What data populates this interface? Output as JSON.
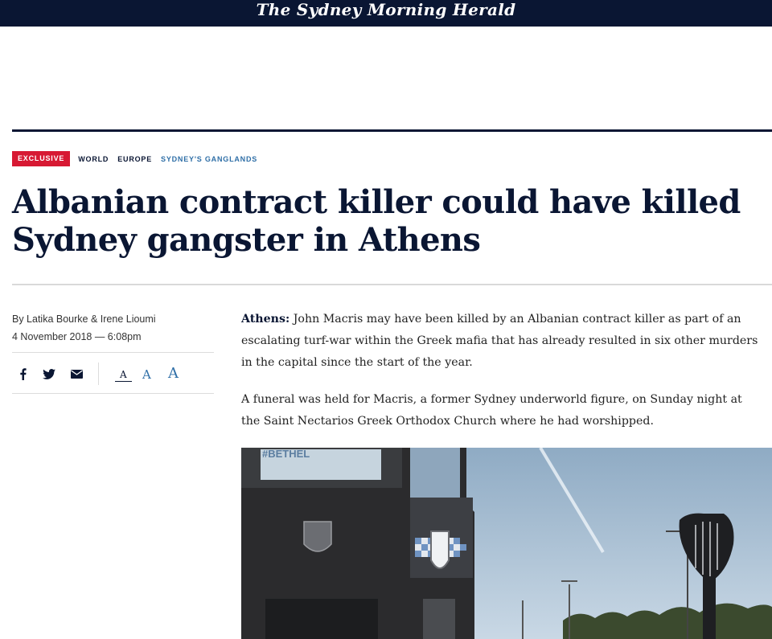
{
  "masthead": {
    "logo_text": "The Sydney Morning Herald"
  },
  "tags": {
    "exclusive": "EXCLUSIVE",
    "world": "WORLD",
    "europe": "EUROPE",
    "section": "SYDNEY'S GANGLANDS"
  },
  "article": {
    "headline": "Albanian contract killer could have killed Sydney gangster in Athens",
    "byline": "By Latika Bourke & Irene Lioumi",
    "dateline": "4 November 2018 — 6:08pm",
    "place": "Athens:",
    "para1": "John Macris may have been killed by an Albanian contract killer as part of an escalating turf-war within the Greek mafia that has already resulted in six other murders in the capital since the start of the year.",
    "para2": "A funeral was held for Macris, a former Sydney underworld figure, on Sunday night at the Saint Nectarios Greek Orthodox Church where he had worshipped.",
    "photo_sign_text": "#BETHEL"
  },
  "share": {
    "icons": [
      "facebook-icon",
      "twitter-icon",
      "email-icon"
    ],
    "font_sizes": [
      "A",
      "A",
      "A"
    ]
  },
  "colors": {
    "navy": "#0a1633",
    "accent_red": "#d71933",
    "link_blue": "#2f6fa7"
  }
}
